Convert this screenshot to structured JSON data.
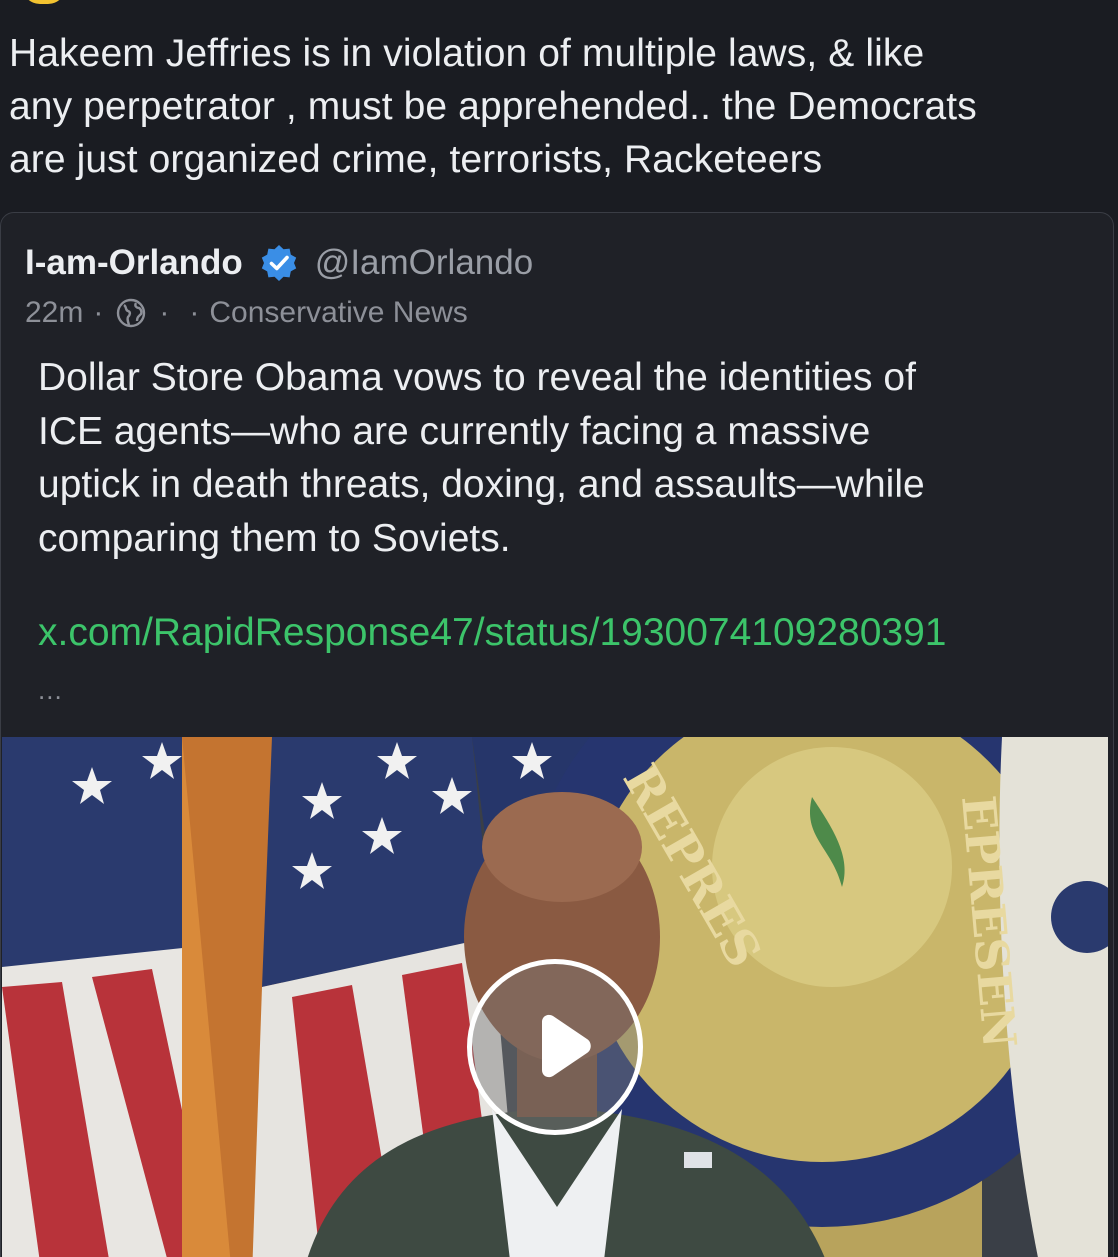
{
  "post": {
    "text_lines": [
      "Hakeem Jeffries is in violation of multiple laws, & like",
      "any perpetrator , must be apprehended.. the Democrats",
      "are just organized crime, terrorists, Racketeers"
    ]
  },
  "quote": {
    "name": "I-am-Orlando",
    "handle": "@IamOrlando",
    "time": "22m",
    "community": "Conservative News",
    "body_lines": [
      "Dollar Store Obama vows to reveal the identities of",
      "ICE agents—who are currently facing a massive",
      "uptick in death threats, doxing, and assaults—while",
      "comparing them to Soviets."
    ],
    "link": "x.com/RapidResponse47/status/1930074109280391",
    "ellipsis": "...",
    "verified_icon": "verified-badge-icon",
    "globe_icon": "globe-icon"
  },
  "media": {
    "type": "video",
    "play_icon": "play-icon"
  },
  "colors": {
    "background": "#1a1c22",
    "card": "#1f2127",
    "link": "#3cc46a",
    "verified": "#3a8ee6",
    "muted": "#8d9098"
  }
}
